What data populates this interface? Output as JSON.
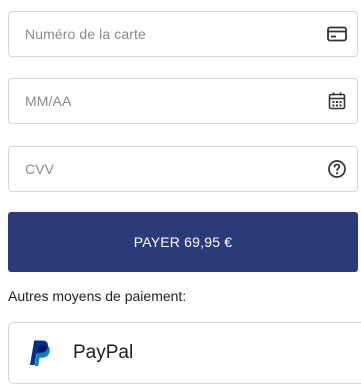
{
  "card_form": {
    "card_number": {
      "placeholder": "Numéro de la carte",
      "value": "",
      "icon": "credit-card-icon"
    },
    "expiry": {
      "placeholder": "MM/AA",
      "value": "",
      "icon": "calendar-icon"
    },
    "cvv": {
      "placeholder": "CVV",
      "value": "",
      "icon": "help-circle-icon"
    },
    "pay_button_label": "PAYER 69,95 €"
  },
  "alternative_payment": {
    "heading": "Autres moyens de paiement:",
    "options": [
      {
        "label": "PayPal",
        "icon": "paypal-logo-icon"
      }
    ]
  },
  "colors": {
    "pay_button_bg": "#2b3a78",
    "paypal_dark_blue": "#003087",
    "paypal_light_blue": "#0079c1",
    "border": "#d6d6d6",
    "placeholder_text": "#8a8a8a"
  }
}
